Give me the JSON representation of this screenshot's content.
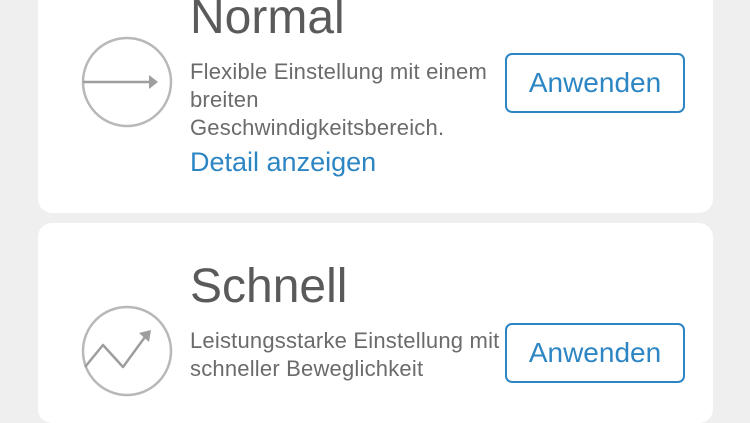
{
  "modes": {
    "normal": {
      "icon": "arrow-right-circle-icon",
      "title": "Normal",
      "description": "Flexible Einstellung mit einem breiten Geschwindigkeitsbereich.",
      "detail_link": "Detail anzeigen",
      "apply_label": "Anwenden"
    },
    "fast": {
      "icon": "zigzag-arrow-circle-icon",
      "title": "Schnell",
      "description": "Leistungsstarke Einstellung mit schneller Beweglichkeit",
      "apply_label": "Anwenden"
    }
  },
  "colors": {
    "accent": "#2d86c3",
    "background": "#efeff0",
    "card": "#ffffff",
    "title": "#5a5a5a",
    "text": "#6b6b6b",
    "icon": "#b8b8b8"
  }
}
